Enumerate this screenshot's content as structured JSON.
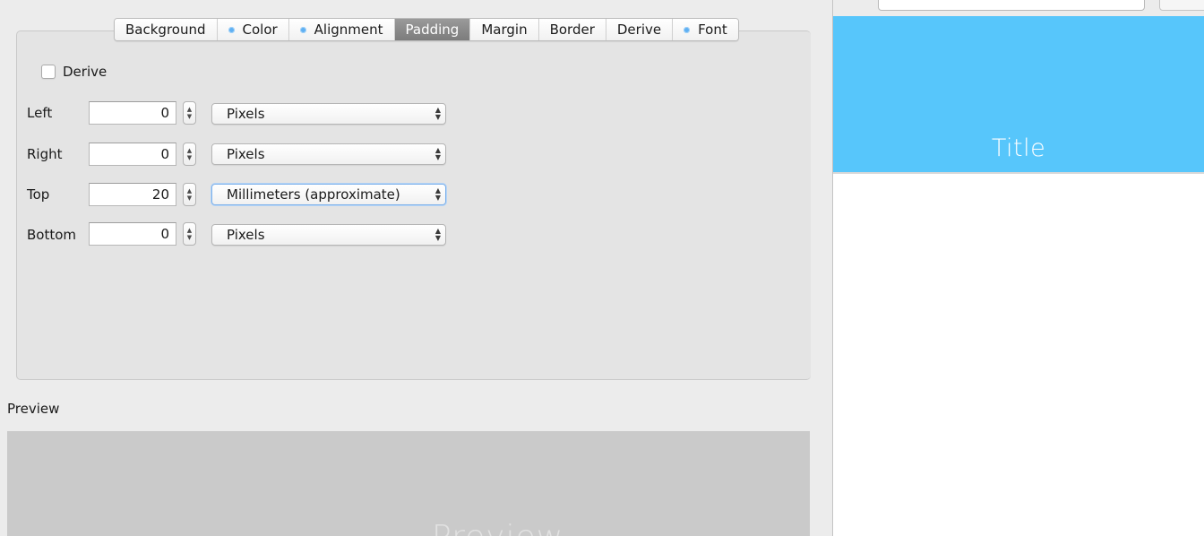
{
  "tabs": [
    {
      "label": "Background",
      "dot": false,
      "active": false
    },
    {
      "label": "Color",
      "dot": true,
      "active": false
    },
    {
      "label": "Alignment",
      "dot": true,
      "active": false
    },
    {
      "label": "Padding",
      "dot": false,
      "active": true
    },
    {
      "label": "Margin",
      "dot": false,
      "active": false
    },
    {
      "label": "Border",
      "dot": false,
      "active": false
    },
    {
      "label": "Derive",
      "dot": false,
      "active": false
    },
    {
      "label": "Font",
      "dot": true,
      "active": false
    }
  ],
  "derive": {
    "label": "Derive",
    "checked": false
  },
  "rows": {
    "left": {
      "label": "Left",
      "value": "0",
      "unit": "Pixels"
    },
    "right": {
      "label": "Right",
      "value": "0",
      "unit": "Pixels"
    },
    "top": {
      "label": "Top",
      "value": "20",
      "unit": "Millimeters (approximate)"
    },
    "bottom": {
      "label": "Bottom",
      "value": "0",
      "unit": "Pixels"
    }
  },
  "preview": {
    "label": "Preview",
    "content": "Preview"
  },
  "canvas": {
    "title": "Title"
  },
  "colors": {
    "accent": "#57c6fb",
    "active_tab": "#8a8a8a",
    "dot": "#5fb0f3"
  },
  "icons": {
    "stepper": "up-down-stepper-icon",
    "select_arrows": "select-arrows-icon"
  }
}
